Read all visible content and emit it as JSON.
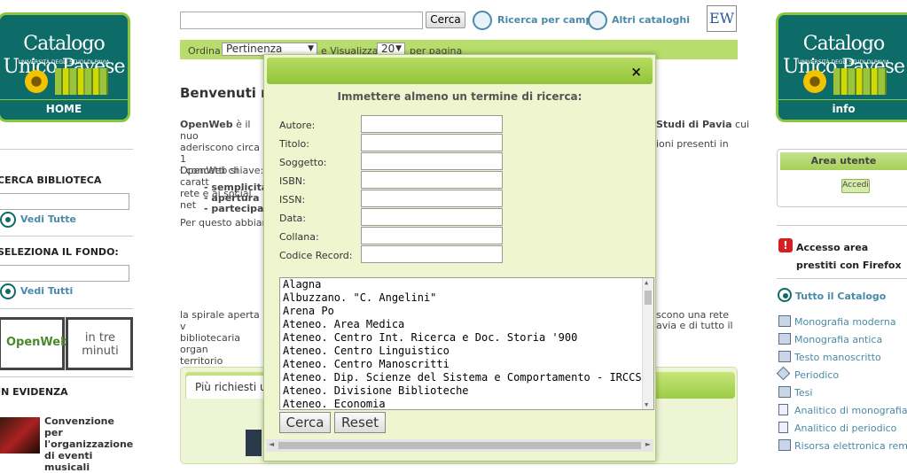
{
  "left": {
    "logo": {
      "title": "Catalogo Unico Pavese",
      "subtitle": "UNIVERSITÀ DEGLI STUDI DI PAVIA",
      "caption": "HOME"
    },
    "search_library_label": "CERCA BIBLIOTECA",
    "see_all_1": "Vedi Tutte",
    "select_fund_label": "SELEZIONA IL FONDO:",
    "see_all_2": "Vedi Tutti",
    "banner_left": "OpenWeb",
    "banner_right": "in tre minuti",
    "evidence_label": "IN EVIDENZA",
    "news_text": "Convenzione per l'organizzazione di eventi musicali"
  },
  "header": {
    "search_button": "Cerca",
    "field_search_link": "Ricerca per campi",
    "other_catalogs_link": "Altri cataloghi",
    "ew_label": "EW",
    "order_label": "Ordina",
    "order_value": "Pertinenza",
    "view_label": "e Visualizza",
    "per_page_value": "20",
    "per_page_label": "per pagina"
  },
  "main": {
    "welcome": "Benvenuti n",
    "p1_bold": "OpenWeb",
    "p1_a": "è il nuo",
    "p1_b": "aderiscono circa 1",
    "p1_c": "OpenWeb si caratt",
    "p1_d": "rete e ai social net",
    "p1_right1": "Studi di Pavia",
    "p1_right1b": "cui",
    "p1_right2": "ioni presenti in",
    "concepts": "I concetti chiave:",
    "bullet1": "- semplicità",
    "bullet2": "- apertura a",
    "bullet3": "- partecipazi",
    "per_questo": "Per questo abbiam",
    "p2_a": "la spirale aperta v",
    "p2_b": "bibliotecaria organ",
    "p2_c": "territorio provincia",
    "p2_right1": "scono una rete",
    "p2_right2": "avia e di tutto il",
    "most_requested": "Più richiesti u"
  },
  "modal": {
    "close": "×",
    "title": "Immettere almeno un termine di ricerca:",
    "fields": [
      "Autore:",
      "Titolo:",
      "Soggetto:",
      "ISBN:",
      "ISSN:",
      "Data:",
      "Collana:",
      "Codice Record:"
    ],
    "libraries": [
      "Alagna",
      "Albuzzano. \"C. Angelini\"",
      "Arena Po",
      "Ateneo. Area Medica",
      "Ateneo. Centro Int. Ricerca e Doc. Storia '900",
      "Ateneo. Centro Linguistico",
      "Ateneo. Centro Manoscritti",
      "Ateneo. Dip. Scienze del Sistema e Comportamento - IRCCS Mondino",
      "Ateneo. Divisione Biblioteche",
      "Ateneo. Economia"
    ],
    "search_button": "Cerca",
    "reset_button": "Reset"
  },
  "right": {
    "logo_caption": "info",
    "user_area_title": "Area utente",
    "login_button": "Accedi",
    "loans_warning": "Accesso area prestiti con Firefox",
    "whole_catalog": "Tutto il Catalogo",
    "types": [
      "Monografia moderna",
      "Monografia antica",
      "Testo manoscritto",
      "Periodico",
      "Tesi",
      "Analitico di monografia",
      "Analitico di periodico",
      "Risorsa elettronica remot"
    ]
  },
  "colors": {
    "brand_teal": "#0d6b68",
    "brand_green": "#8cc63f",
    "bar_green": "#b7dd6a",
    "link_blue": "#4a8aa8"
  }
}
